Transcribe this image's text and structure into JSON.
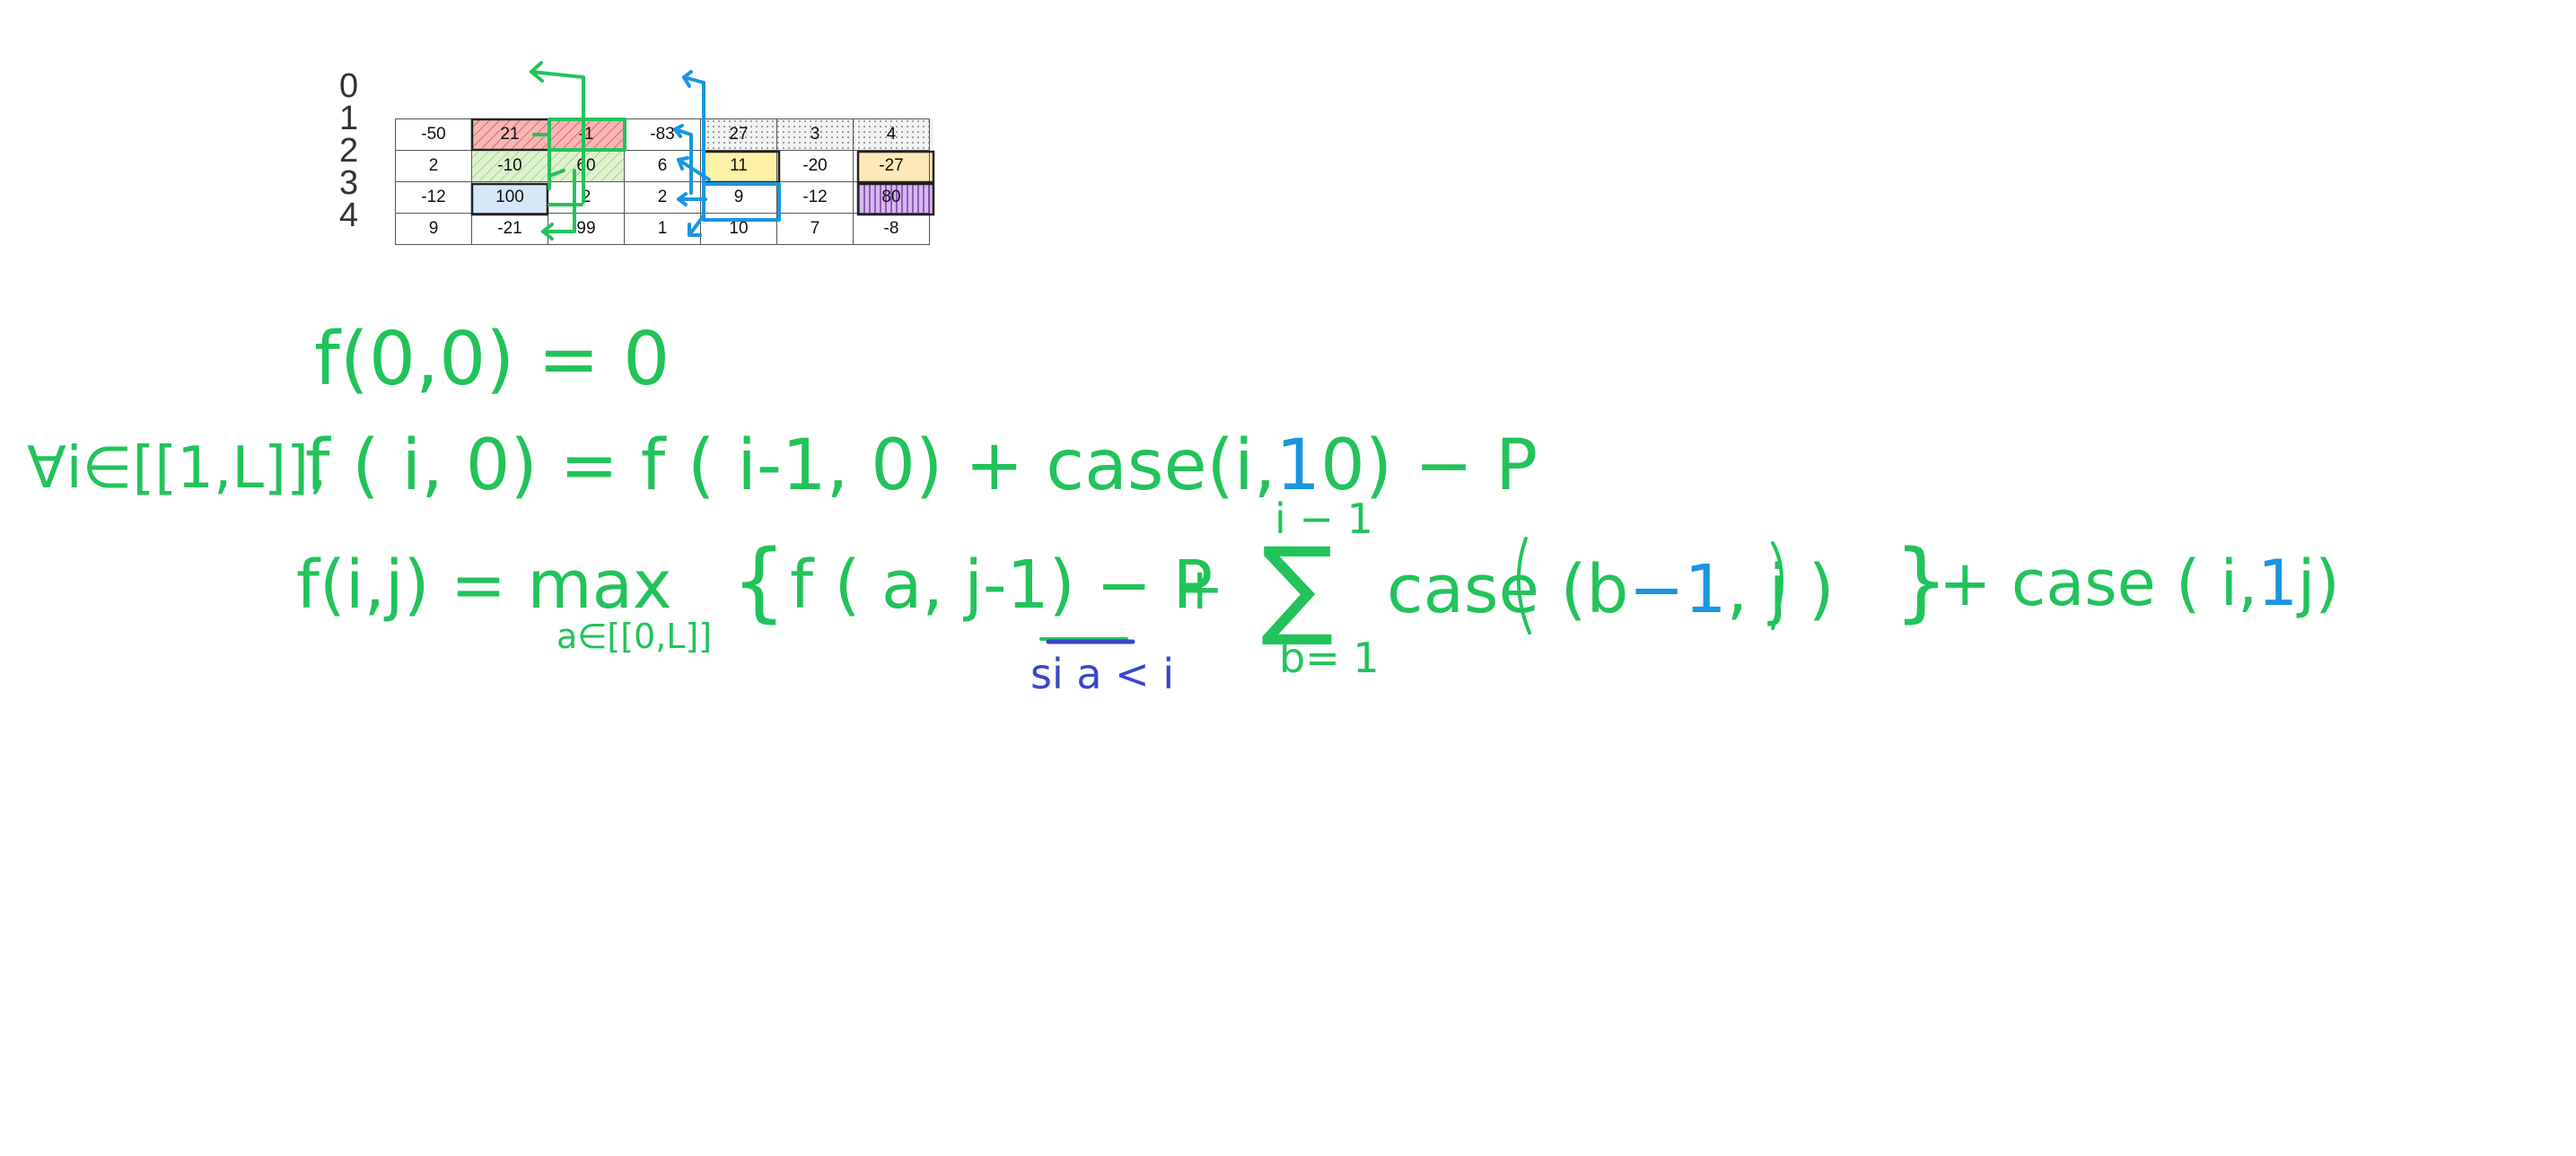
{
  "row_labels": [
    "0",
    "1",
    "2",
    "3",
    "4"
  ],
  "grid": {
    "rows": [
      [
        "-50",
        "21",
        "-1",
        "-83",
        "27",
        "3",
        "4"
      ],
      [
        "2",
        "-10",
        "60",
        "6",
        "11",
        "-20",
        "-27"
      ],
      [
        "-12",
        "100",
        "2",
        "2",
        "9",
        "-12",
        "80"
      ],
      [
        "9",
        "-21",
        "99",
        "1",
        "10",
        "7",
        "-8"
      ]
    ]
  },
  "colors": {
    "green_ink": "#22c35a",
    "blue_ink": "#1a96e0",
    "dark_blue_ink": "#3a46c8",
    "cell_red": "#f7b6b6",
    "cell_green": "#d8efc8",
    "cell_yellow": "#fdf1a6",
    "cell_orange": "#fde9b8",
    "cell_blue": "#d6e8f7",
    "cell_purple": "#c8a6e6"
  },
  "equations": {
    "base": "f(0,0) = 0",
    "forall": "∀i∈[[1,L]],",
    "line2_lhs": "f ( i, 0) = f ( i-1, 0) + case(i,",
    "line2_one": "1",
    "line2_rhs": "0) − P",
    "line3_lhs": "f(i,j) = max",
    "line3_sub": "a∈[[0,L]]",
    "line3_brace_open": "{",
    "line3_term": "f ( a, j-1) − P",
    "line3_plus": "+",
    "sum_top": "i − 1",
    "sum_symbol": "∑",
    "sum_bottom": "b= 1",
    "line3_case_a": "case (b",
    "line3_case_minus1": "−1",
    "line3_case_b": ", j )",
    "line3_brace_close": "}",
    "line3_tail_a": "+ case ( i,",
    "line3_tail_one": "1",
    "line3_tail_b": "j)",
    "condition": "si a < i"
  }
}
